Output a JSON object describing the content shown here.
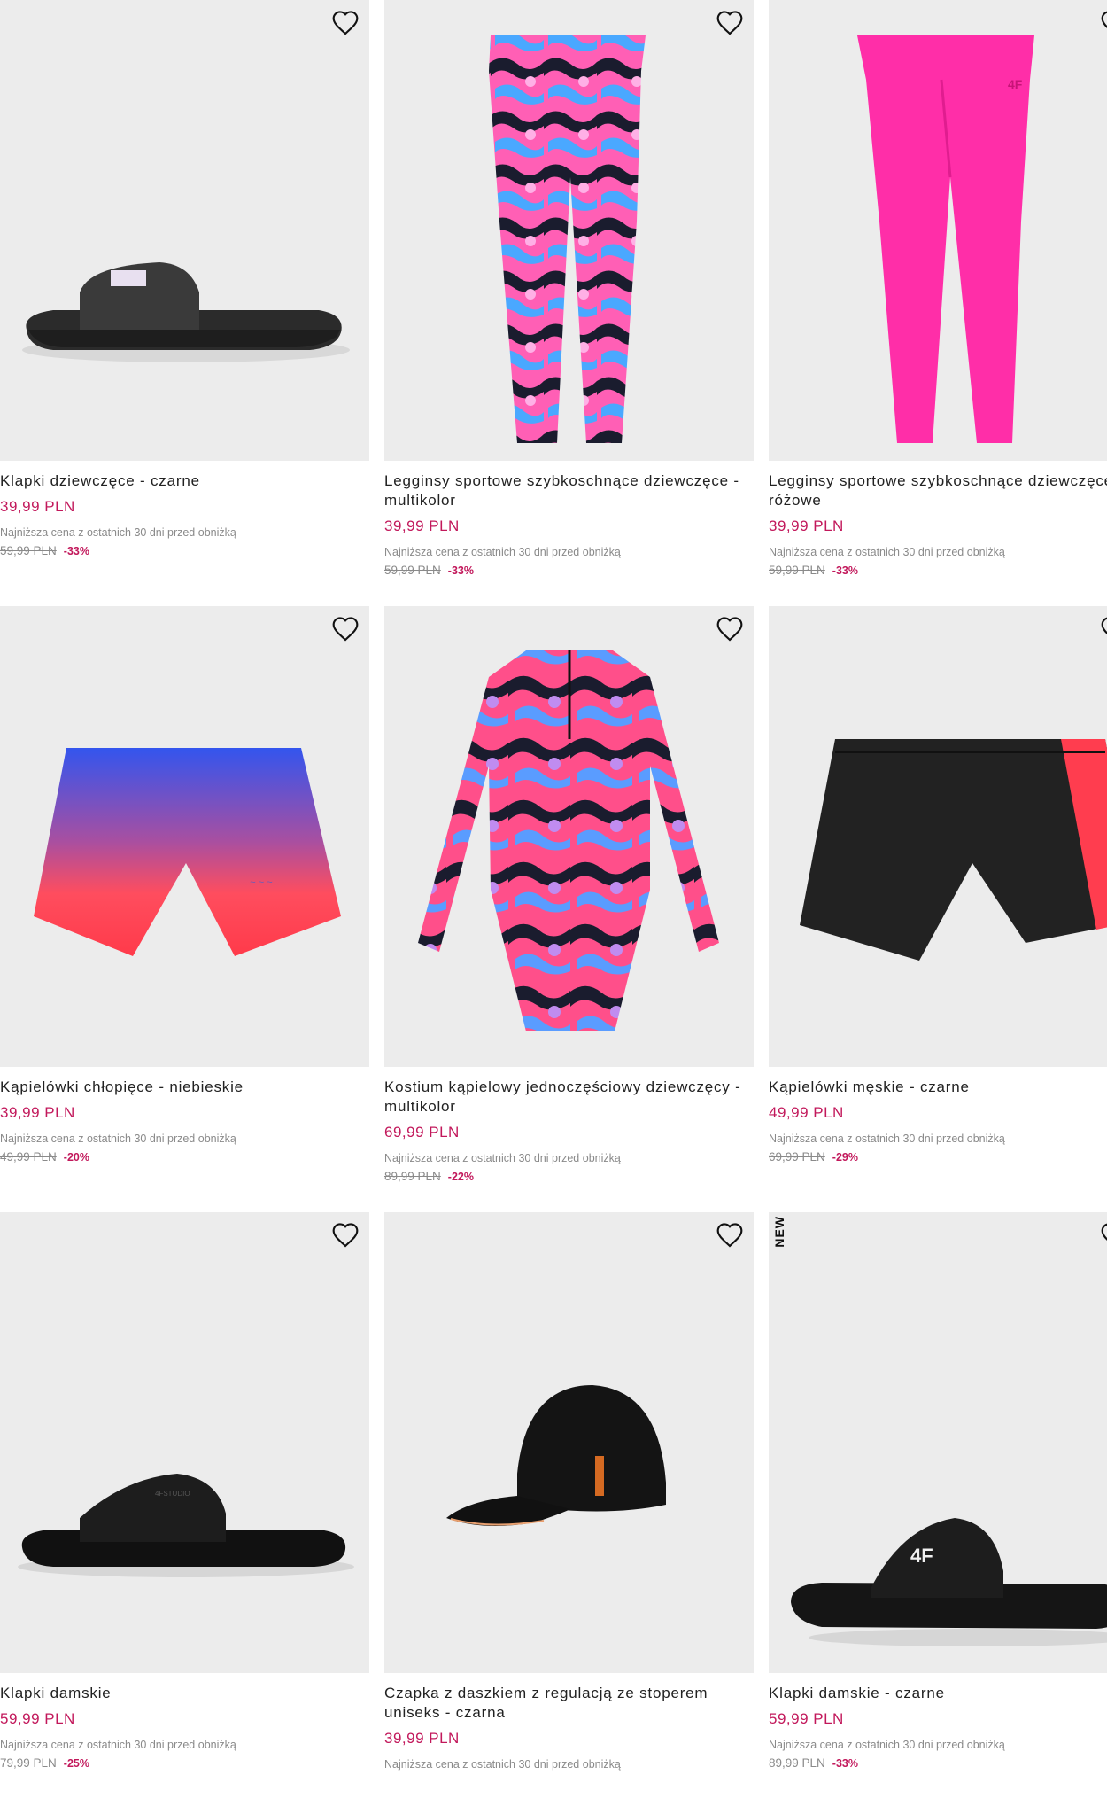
{
  "products": [
    {
      "name": "Klapki dziewczęce - czarne",
      "price": "39,99 PLN",
      "lowest_label": "Najniższa cena z ostatnich 30 dni przed obniżką",
      "old_price": "59,99 PLN",
      "discount": "-33%"
    },
    {
      "name": "Legginsy sportowe szybkoschnące dziewczęce - multikolor",
      "price": "39,99 PLN",
      "lowest_label": "Najniższa cena z ostatnich 30 dni przed obniżką",
      "old_price": "59,99 PLN",
      "discount": "-33%"
    },
    {
      "name": "Legginsy sportowe szybkoschnące dziewczęce - różowe",
      "price": "39,99 PLN",
      "lowest_label": "Najniższa cena z ostatnich 30 dni przed obniżką",
      "old_price": "59,99 PLN",
      "discount": "-33%"
    },
    {
      "name": "Kąpielówki chłopięce - niebieskie",
      "price": "39,99 PLN",
      "lowest_label": "Najniższa cena z ostatnich 30 dni przed obniżką",
      "old_price": "49,99 PLN",
      "discount": "-20%"
    },
    {
      "name": "Kostium kąpielowy jednoczęściowy dziewczęcy - multikolor",
      "price": "69,99 PLN",
      "lowest_label": "Najniższa cena z ostatnich 30 dni przed obniżką",
      "old_price": "89,99 PLN",
      "discount": "-22%"
    },
    {
      "name": "Kąpielówki męskie - czarne",
      "price": "49,99 PLN",
      "lowest_label": "Najniższa cena z ostatnich 30 dni przed obniżką",
      "old_price": "69,99 PLN",
      "discount": "-29%"
    },
    {
      "name": "Klapki damskie",
      "price": "59,99 PLN",
      "lowest_label": "Najniższa cena z ostatnich 30 dni przed obniżką",
      "old_price": "79,99 PLN",
      "discount": "-25%"
    },
    {
      "name": "Czapka z daszkiem z regulacją ze stoperem uniseks - czarna",
      "price": "39,99 PLN",
      "lowest_label": "Najniższa cena z ostatnich 30 dni przed obniżką",
      "old_price": "",
      "discount": ""
    },
    {
      "name": "Klapki damskie - czarne",
      "price": "59,99 PLN",
      "lowest_label": "Najniższa cena z ostatnich 30 dni przed obniżką",
      "old_price": "89,99 PLN",
      "discount": "-33%",
      "badge": "NEW"
    }
  ],
  "icons": {
    "wishlist": "heart-outline-icon"
  },
  "colors": {
    "price": "#c2185b",
    "image_bg": "#ececec",
    "muted": "#8a8a8a"
  }
}
